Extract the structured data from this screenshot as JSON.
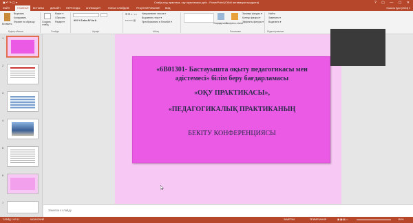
{
  "window": {
    "title": "Слайд под практика, оқу практикасы.pptx - PowerPoint (Сбой активации продукта)",
    "controls": "? ▢ — ▢ ✕"
  },
  "ribbon_tabs": [
    "ФАЙЛ",
    "ГЛАВНАЯ",
    "ВСТАВКА",
    "ДИЗАЙН",
    "ПЕРЕХОДЫ",
    "АНИМАЦИЯ",
    "ПОКАЗ СЛАЙДОВ",
    "РЕЦЕНЗИРОВАНИЕ",
    "ВИД"
  ],
  "active_tab_index": 1,
  "user": "Нәзила Қуат [2024] ▾",
  "ribbon": {
    "paste": "Вставить",
    "cut": "Вырезать",
    "copy": "Копировать",
    "format_painter": "Формат по образцу",
    "new_slide": "Создать слайд",
    "layout": "Макет ▾",
    "reset": "Сбросить",
    "section": "Раздел ▾",
    "text_direction": "Направление текста ▾",
    "align_text": "Выровнять текст ▾",
    "smartart": "Преобразовать в SmartArt ▾",
    "arrange": "Упорядочить",
    "quick_styles": "Экспресс-стили",
    "shape_fill": "Заливка фигуры ▾",
    "shape_outline": "Контур фигуры ▾",
    "shape_effects": "Эффекты фигуры ▾",
    "find": "Найти",
    "replace": "Заменить ▾",
    "select": "Выделить ▾",
    "groups": {
      "clipboard": "Буфер обмена",
      "slides": "Слайды",
      "font": "Шрифт",
      "paragraph": "Абзац",
      "drawing": "Рисование",
      "editing": "Редактирование"
    }
  },
  "slides": [
    {
      "num": "1"
    },
    {
      "num": "2"
    },
    {
      "num": "3"
    },
    {
      "num": "4"
    },
    {
      "num": "5"
    },
    {
      "num": "6"
    },
    {
      "num": "7"
    }
  ],
  "slide": {
    "line1": "«6В01301- Бастауышта оқыту педагогикасы мен",
    "line2": "әдістемесі» білім беру бағдарламасы",
    "line3": "«ОҚУ ПРАКТИКАСЫ»,",
    "line4": "«ПЕДАГОГИКАЛЫҚ ПРАКТИКАНЫҢ",
    "line5": "БЕКІТУ КОНФЕРЕНЦИЯСЫ"
  },
  "notes_placeholder": "Заметки к слайду",
  "status": {
    "slide_info": "СЛАЙД 1 ИЗ 11",
    "language": "КАЗАХСКИЙ",
    "notes_btn": "ЗАМЕТКИ",
    "comments_btn": "ПРИМЕЧАНИЯ",
    "zoom": "116%"
  },
  "colors": {
    "accent": "#b7472a",
    "slide_bg": "#f6c8f3",
    "box_fill": "#ea5ae4",
    "text": "#2a2a4a"
  }
}
